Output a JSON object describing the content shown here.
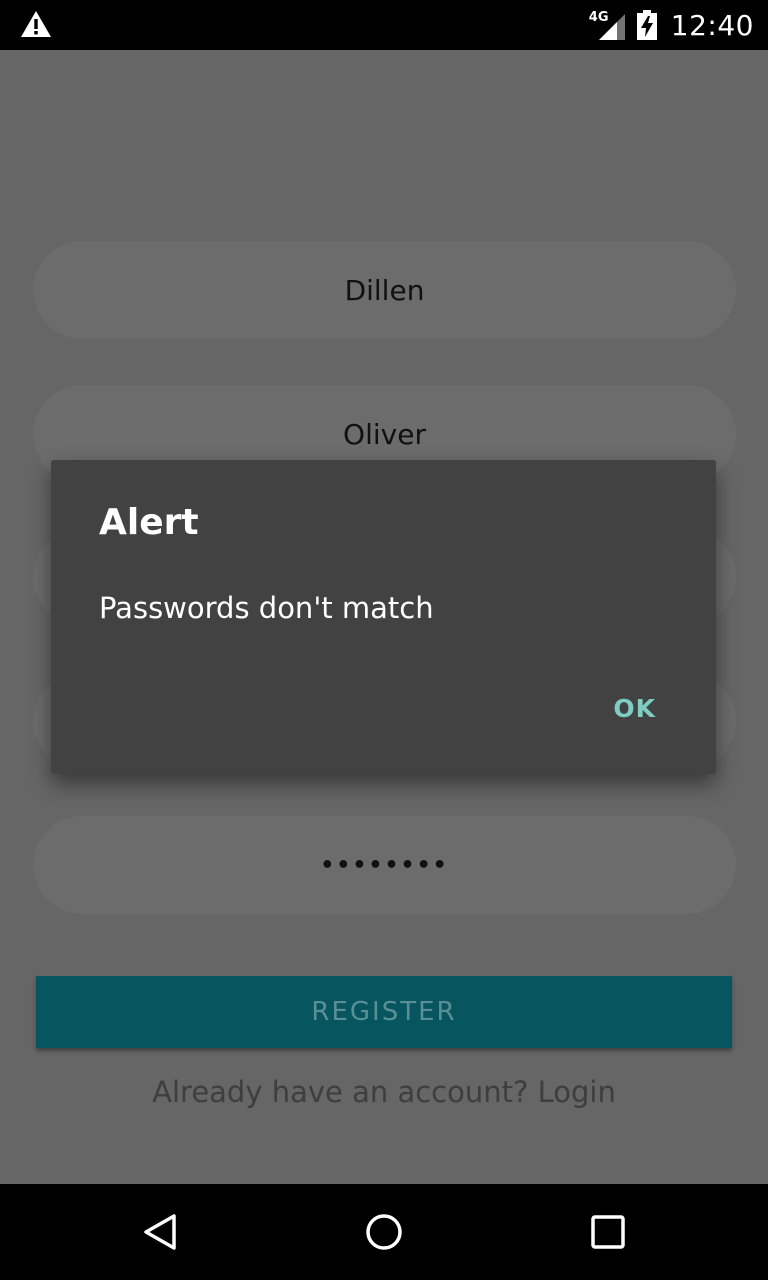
{
  "status_bar": {
    "network_label": "4G",
    "time": "12:40",
    "icons": [
      "warning-icon",
      "signal-icon",
      "battery-charging-icon"
    ]
  },
  "form": {
    "first_name_value": "Dillen",
    "last_name_value": "Oliver",
    "password_value": "••••••••",
    "register_label": "REGISTER",
    "login_link_text": "Already have an account? Login"
  },
  "dialog": {
    "title": "Alert",
    "message": "Passwords don't match",
    "ok_label": "OK"
  },
  "nav_bar": {
    "icons": [
      "back-icon",
      "home-icon",
      "recents-icon"
    ]
  },
  "colors": {
    "accent": "#80cbc4",
    "register_bg": "#07555f",
    "dialog_bg": "#424242"
  }
}
